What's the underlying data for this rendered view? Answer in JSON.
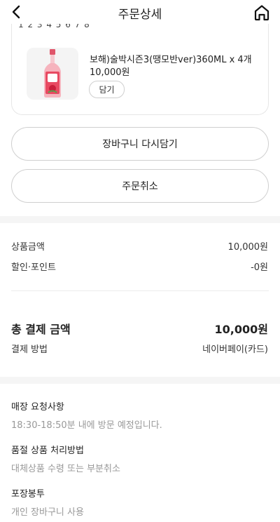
{
  "header": {
    "title": "주문상세"
  },
  "card": {
    "cut_text": "1 2 3 4 5 6 7 8",
    "product": {
      "name": "보해)술박시즌3(땡모반ver)360ML x 4개",
      "price": "10,000원",
      "add_label": "담기"
    }
  },
  "actions": {
    "reorder_label": "장바구니 다시담기",
    "cancel_label": "주문취소"
  },
  "summary": {
    "product_amount_label": "상품금액",
    "product_amount_value": "10,000원",
    "discount_label": "할인·포인트",
    "discount_value": "-0원",
    "total_label": "총 결제 금액",
    "total_value": "10,000원",
    "method_label": "결제 방법",
    "method_value": "네이버페이(카드)"
  },
  "info": {
    "store_request_title": "매장 요청사항",
    "store_request_body": "18:30-18:50분 내에 방문 예정입니다.",
    "soldout_title": "품절 상품 처리방법",
    "soldout_body": "대체상품 수령 또는 부분취소",
    "bag_title": "포장봉투",
    "bag_body": "개인 장바구니 사용"
  }
}
